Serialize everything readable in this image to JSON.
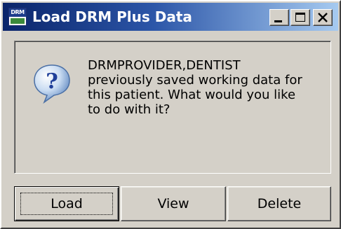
{
  "window": {
    "title": "Load DRM Plus Data",
    "icon": "drm-plus-app-icon",
    "icon_text": "DRM",
    "title_gradient": [
      "#0a246a",
      "#a6caf0"
    ]
  },
  "caption_buttons": {
    "minimize": "minimize-icon",
    "maximize": "maximize-icon",
    "close": "close-icon"
  },
  "dialog": {
    "icon": "question-icon",
    "message": "DRMPROVIDER,DENTIST\npreviously saved working data for\nthis patient.  What would you like\nto do with it?"
  },
  "buttons": {
    "load_label": "Load",
    "view_label": "View",
    "delete_label": "Delete"
  }
}
